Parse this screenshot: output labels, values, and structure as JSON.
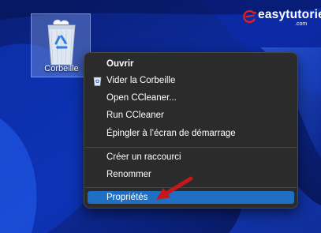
{
  "desktop": {
    "recycle_bin_label": "Corbeille",
    "icon": "recycle-bin-icon"
  },
  "watermark": {
    "name": "easytutoriel",
    "suffix": ".com",
    "logo_letter": "e",
    "brand_color": "#e0201e"
  },
  "context_menu": {
    "items": [
      {
        "label": "Ouvrir",
        "bold": true
      },
      {
        "label": "Vider la Corbeille",
        "icon": "recycle-bin-icon"
      },
      {
        "label": "Open CCleaner..."
      },
      {
        "label": "Run CCleaner"
      },
      {
        "label": "Épingler à l’écran de démarrage"
      },
      {
        "label": "Créer un raccourci"
      },
      {
        "label": "Renommer"
      },
      {
        "label": "Propriétés",
        "highlighted": true
      }
    ],
    "highlight_color": "#1f6fc4",
    "annotation": "red-arrow-pointing-to-properties"
  }
}
